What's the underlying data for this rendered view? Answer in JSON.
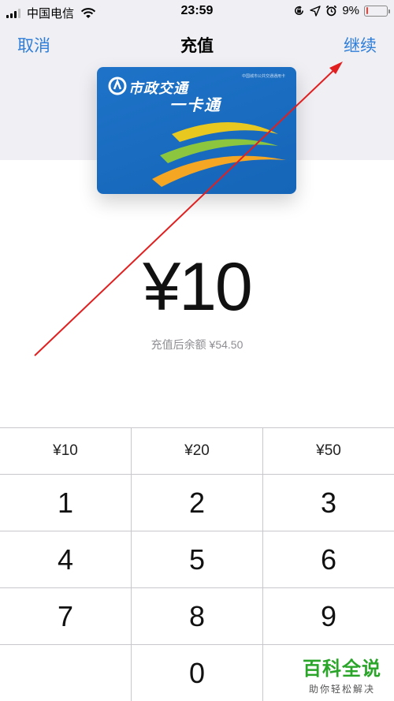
{
  "status_bar": {
    "carrier": "中国电信",
    "time": "23:59",
    "battery_percent": "9%",
    "battery_level": 0.09,
    "icons": [
      "signal-icon",
      "wifi-icon",
      "lock-rotation-icon",
      "location-icon",
      "alarm-icon",
      "battery-icon"
    ]
  },
  "nav": {
    "cancel_label": "取消",
    "title": "充值",
    "continue_label": "继续"
  },
  "card": {
    "brand": "市政交通",
    "name": "一卡通",
    "small_text": "中国城市公共交通通用卡",
    "colors": {
      "background": "#1565b8",
      "accent_yellow": "#e8c81e",
      "accent_green": "#8cc63f",
      "accent_orange": "#f5a623"
    }
  },
  "amount": {
    "value": "¥10",
    "balance_text": "充值后余额 ¥54.50"
  },
  "keypad": {
    "presets": [
      "¥10",
      "¥20",
      "¥50"
    ],
    "rows": [
      [
        "1",
        "2",
        "3"
      ],
      [
        "4",
        "5",
        "6"
      ],
      [
        "7",
        "8",
        "9"
      ],
      [
        "",
        "0",
        ""
      ]
    ]
  },
  "watermark": {
    "main": "百科全说",
    "sub": "助你轻松解决"
  },
  "colors": {
    "link": "#2f7ed8",
    "annotation_arrow": "#e02020"
  }
}
